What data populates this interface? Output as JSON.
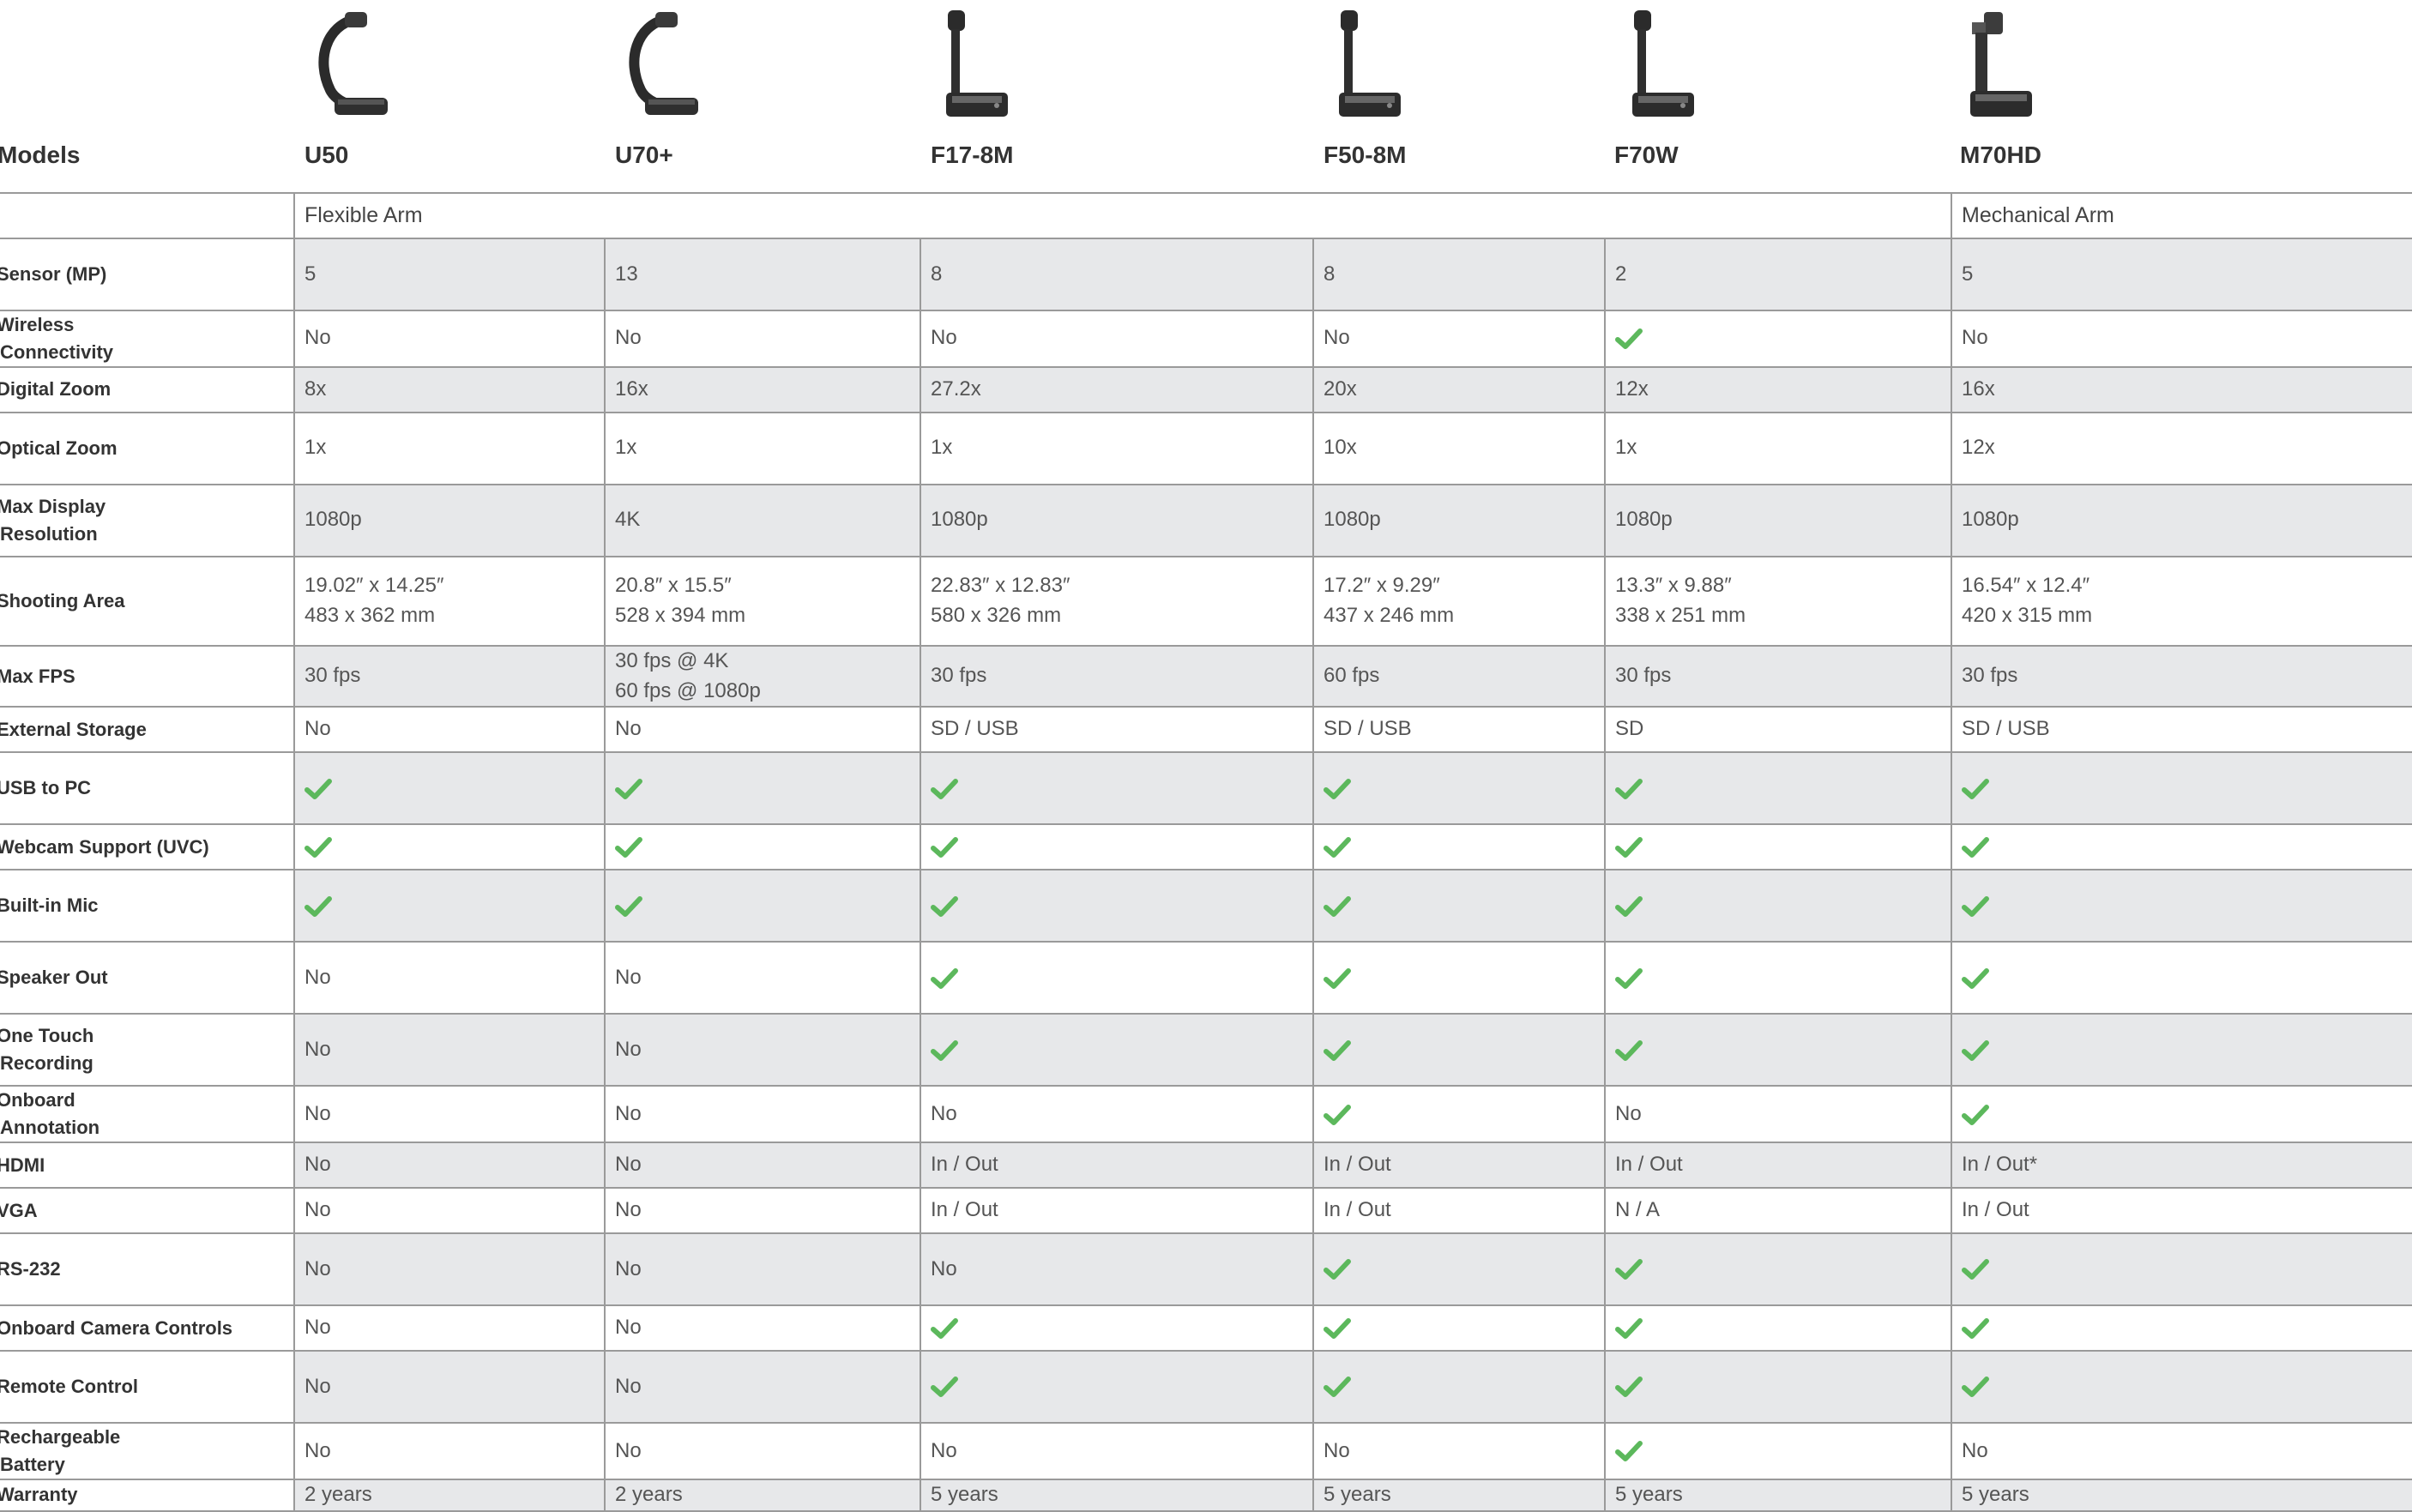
{
  "header": {
    "models_label": "Models",
    "models": [
      "U50",
      "U70+",
      "F17-8M",
      "F50-8M",
      "F70W",
      "M70HD"
    ]
  },
  "product_images": [
    "flexible-arm-camera-icon",
    "flexible-arm-camera-icon",
    "fixed-arm-camera-icon",
    "fixed-arm-camera-icon",
    "fixed-arm-camera-icon",
    "mechanical-arm-camera-icon"
  ],
  "categories": {
    "flexible": "Flexible Arm",
    "mechanical": "Mechanical Arm"
  },
  "check_color": "#5cb85c",
  "rows": [
    {
      "label": "Sensor (MP)",
      "cells": [
        "5",
        "13",
        "8",
        "8",
        "2",
        "5"
      ]
    },
    {
      "label": "Wireless\nConnectivity",
      "cells": [
        "No",
        "No",
        "No",
        "No",
        "check",
        "No"
      ]
    },
    {
      "label": "Digital Zoom",
      "cells": [
        "8x",
        "16x",
        "27.2x",
        "20x",
        "12x",
        "16x"
      ]
    },
    {
      "label": "Optical Zoom",
      "cells": [
        "1x",
        "1x",
        "1x",
        "10x",
        "1x",
        "12x"
      ]
    },
    {
      "label": "Max Display\nResolution",
      "cells": [
        "1080p",
        "4K",
        "1080p",
        "1080p",
        "1080p",
        "1080p"
      ]
    },
    {
      "label": "Shooting Area",
      "cells": [
        "19.02″ x 14.25″\n483 x 362 mm",
        "20.8″ x 15.5″\n528 x 394 mm",
        "22.83″ x 12.83″\n580 x 326 mm",
        "17.2″ x 9.29″\n437 x 246 mm",
        "13.3″ x 9.88″\n338 x 251 mm",
        "16.54″ x 12.4″\n420 x 315 mm"
      ]
    },
    {
      "label": "Max FPS",
      "cells": [
        "30 fps",
        "30 fps @ 4K\n60 fps @ 1080p",
        "30 fps",
        "60 fps",
        "30 fps",
        "30 fps"
      ]
    },
    {
      "label": "External Storage",
      "cells": [
        "No",
        "No",
        "SD / USB",
        "SD / USB",
        "SD",
        "SD / USB"
      ]
    },
    {
      "label": "USB to PC",
      "cells": [
        "check",
        "check",
        "check",
        "check",
        "check",
        "check"
      ]
    },
    {
      "label": "Webcam Support (UVC)",
      "cells": [
        "check",
        "check",
        "check",
        "check",
        "check",
        "check"
      ]
    },
    {
      "label": "Built-in Mic",
      "cells": [
        "check",
        "check",
        "check",
        "check",
        "check",
        "check"
      ]
    },
    {
      "label": "Speaker Out",
      "cells": [
        "No",
        "No",
        "check",
        "check",
        "check",
        "check"
      ]
    },
    {
      "label": "One Touch\nRecording",
      "cells": [
        "No",
        "No",
        "check",
        "check",
        "check",
        "check"
      ]
    },
    {
      "label": "Onboard\nAnnotation",
      "cells": [
        "No",
        "No",
        "No",
        "check",
        "No",
        "check"
      ]
    },
    {
      "label": "HDMI",
      "cells": [
        "No",
        "No",
        "In / Out",
        "In / Out",
        "In / Out",
        "In / Out*"
      ]
    },
    {
      "label": "VGA",
      "cells": [
        "No",
        "No",
        "In / Out",
        "In / Out",
        "N / A",
        "In / Out"
      ]
    },
    {
      "label": "RS-232",
      "cells": [
        "No",
        "No",
        "No",
        "check",
        "check",
        "check"
      ]
    },
    {
      "label": "Onboard Camera Controls",
      "cells": [
        "No",
        "No",
        "check",
        "check",
        "check",
        "check"
      ]
    },
    {
      "label": "Remote Control",
      "cells": [
        "No",
        "No",
        "check",
        "check",
        "check",
        "check"
      ]
    },
    {
      "label": "Rechargeable\nBattery",
      "cells": [
        "No",
        "No",
        "No",
        "No",
        "check",
        "No"
      ]
    },
    {
      "label": "Warranty",
      "cells": [
        "2 years",
        "2 years",
        "5 years",
        "5 years",
        "5 years",
        "5 years"
      ]
    }
  ]
}
